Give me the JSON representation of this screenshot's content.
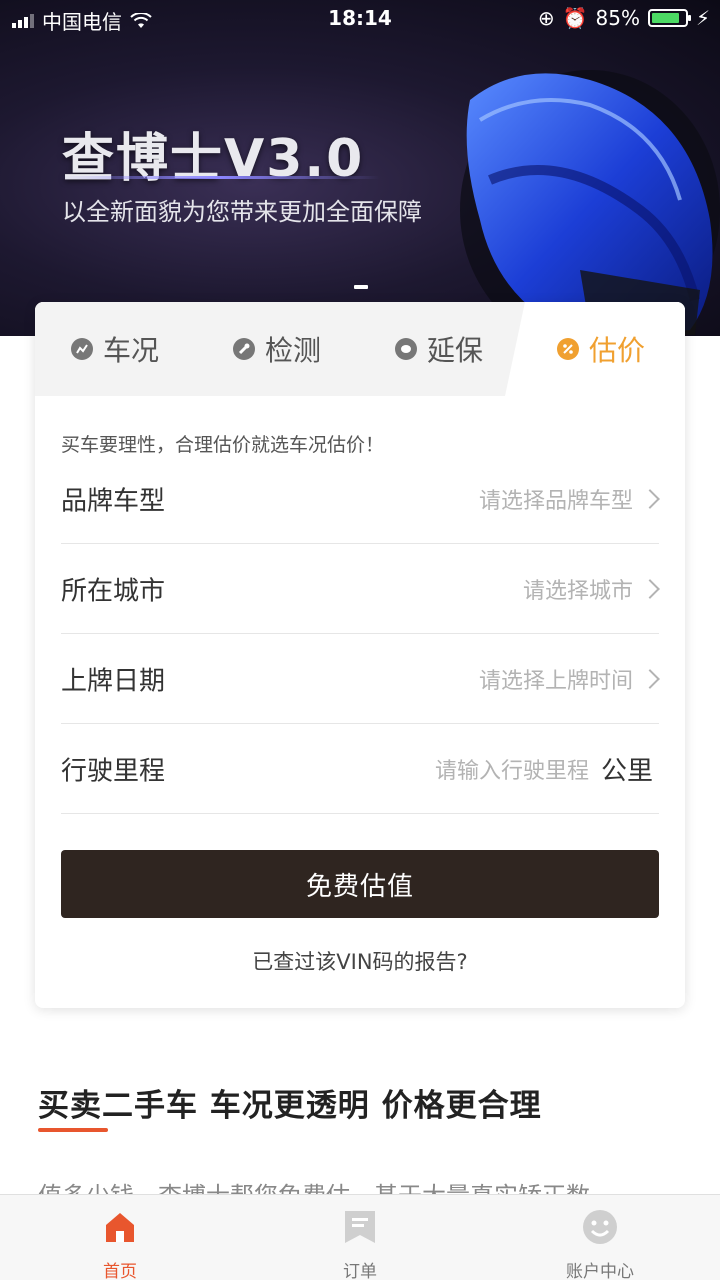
{
  "status_bar": {
    "carrier": "中国电信",
    "time": "18:14",
    "battery": "85%",
    "battery_level": 0.85
  },
  "banner": {
    "title": "查博士V3.0",
    "subtitle": "以全新面貌为您带来更加全面保障"
  },
  "tabs": [
    {
      "label": "车况",
      "icon": "chart-icon"
    },
    {
      "label": "检测",
      "icon": "wrench-icon"
    },
    {
      "label": "延保",
      "icon": "shield-icon"
    },
    {
      "label": "估价",
      "icon": "percent-icon",
      "active": true
    }
  ],
  "form": {
    "tagline": "买车要理性，合理估价就选车况估价！",
    "brand": {
      "label": "品牌车型",
      "value": "请选择品牌车型"
    },
    "city": {
      "label": "所在城市",
      "value": "请选择城市"
    },
    "date": {
      "label": "上牌日期",
      "value": "请选择上牌时间"
    },
    "mileage": {
      "label": "行驶里程",
      "placeholder": "请输入行驶里程",
      "unit": "公里"
    },
    "submit_label": "免费估值",
    "vin_link": "已查过该VIN码的报告?"
  },
  "section": {
    "title": "买卖二手车 车况更透明 价格更合理",
    "text": "值多少钱，查博士帮您免费估，基于大量真实矫正数"
  },
  "tabbar": [
    {
      "label": "首页",
      "icon": "home-icon",
      "active": true
    },
    {
      "label": "订单",
      "icon": "bookmark-icon"
    },
    {
      "label": "账户中心",
      "icon": "smile-icon"
    }
  ],
  "colors": {
    "accent": "#e8562e",
    "tab_active": "#f0a030",
    "button": "#2f2520"
  }
}
